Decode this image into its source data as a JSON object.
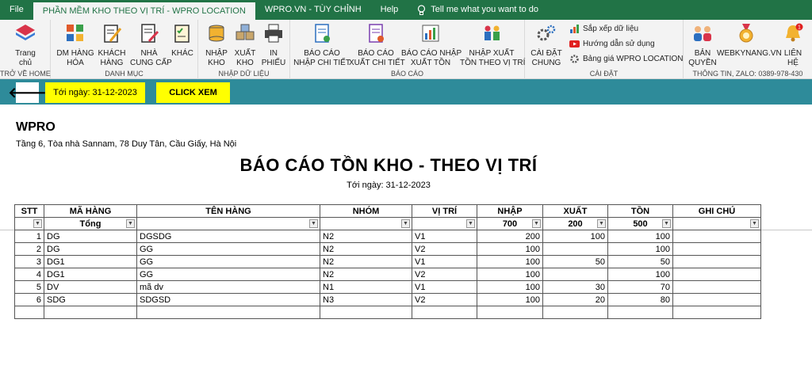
{
  "tabs": [
    "File",
    "PHẦN MỀM KHO THEO VỊ TRÍ - WPRO LOCATION",
    "WPRO.VN - TÙY CHỈNH",
    "Help"
  ],
  "tell_me": "Tell me what you want to do",
  "ribbon": {
    "home": {
      "btn": [
        "Trang",
        "chủ"
      ],
      "group": "TRỞ VỀ HOME"
    },
    "danhmuc": {
      "group": "DANH MỤC",
      "buttons": [
        [
          "DM HÀNG",
          "HÓA"
        ],
        [
          "KHÁCH",
          "HÀNG"
        ],
        [
          "NHÀ",
          "CUNG CẤP"
        ],
        [
          "KHÁC",
          ""
        ]
      ]
    },
    "nhap": {
      "group": "NHẬP DỮ LIỆU",
      "buttons": [
        [
          "NHẬP",
          "KHO"
        ],
        [
          "XUẤT",
          "KHO"
        ],
        [
          "IN",
          "PHIẾU"
        ]
      ]
    },
    "baocao": {
      "group": "BÁO CÁO",
      "buttons": [
        [
          "BÁO CÁO",
          "NHẬP CHI TIẾT"
        ],
        [
          "BÁO CÁO",
          "XUẤT CHI TIẾT"
        ],
        [
          "BÁO CÁO NHẬP",
          "XUẤT TỒN"
        ],
        [
          "NHẬP XUẤT",
          "TỒN THEO VỊ TRÍ"
        ]
      ]
    },
    "caidat": {
      "group": "CÀI ĐẶT",
      "main": [
        "CÀI ĐẶT",
        "CHUNG"
      ],
      "small": [
        "Sắp xếp dữ liệu",
        "Hướng dẫn sử dụng",
        "Bảng giá WPRO LOCATION"
      ]
    },
    "thongtin": {
      "group": "THÔNG TIN, ZALO: 0389-978-430",
      "buttons": [
        [
          "BẢN",
          "QUYỀN"
        ],
        [
          "WEBKYNANG.VN",
          ""
        ],
        [
          "LIÊN",
          "HỆ"
        ]
      ],
      "badge": "1"
    }
  },
  "toolbar": {
    "back": "🡐",
    "date_label": "Tới ngày: 31-12-2023",
    "click_label": "CLICK XEM"
  },
  "report": {
    "company": "WPRO",
    "address": "Tầng 6, Tòa nhà Sannam, 78 Duy Tân, Cầu Giấy, Hà Nội",
    "title": "BÁO CÁO TỒN KHO - THEO VỊ TRÍ",
    "date": "Tới ngày: 31-12-2023",
    "headers": [
      "STT",
      "MÃ HÀNG",
      "TÊN HÀNG",
      "NHÓM",
      "VỊ TRÍ",
      "NHẬP",
      "XUẤT",
      "TỒN",
      "GHI CHÚ"
    ],
    "totals": {
      "label": "Tổng",
      "nhap": "700",
      "xuat": "200",
      "ton": "500"
    },
    "rows": [
      [
        "1",
        "DG",
        "DGSDG",
        "N2",
        "V1",
        "200",
        "100",
        "100",
        ""
      ],
      [
        "2",
        "DG",
        "GG",
        "N2",
        "V2",
        "100",
        "",
        "100",
        ""
      ],
      [
        "3",
        "DG1",
        "GG",
        "N2",
        "V1",
        "100",
        "50",
        "50",
        ""
      ],
      [
        "4",
        "DG1",
        "GG",
        "N2",
        "V2",
        "100",
        "",
        "100",
        ""
      ],
      [
        "5",
        "DV",
        "mã dv",
        "N1",
        "V1",
        "100",
        "30",
        "70",
        ""
      ],
      [
        "6",
        "SDG",
        "SDGSD",
        "N3",
        "V2",
        "100",
        "20",
        "80",
        ""
      ],
      [
        "",
        "",
        "",
        "",
        "",
        "",
        "",
        "",
        ""
      ]
    ]
  },
  "colors": {
    "ribbon_green": "#217346",
    "toolbar_teal": "#2e8b9a",
    "highlight_yellow": "#ffff00"
  }
}
